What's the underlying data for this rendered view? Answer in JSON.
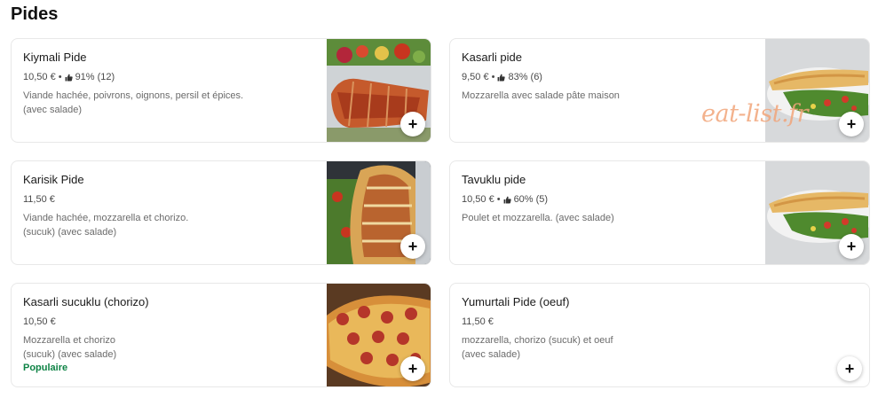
{
  "section": {
    "title": "Pides"
  },
  "items": [
    {
      "name": "Kiymali Pide",
      "price": "10,50 €",
      "rating": "91% (12)",
      "desc_line1": "Viande hachée, poivrons, oignons, persil et épices.",
      "desc_line2": "(avec salade)",
      "badge": "",
      "add_label": "+"
    },
    {
      "name": "Kasarli pide",
      "price": "9,50 €",
      "rating": "83% (6)",
      "desc_line1": "Mozzarella avec salade pâte maison",
      "desc_line2": "",
      "badge": "",
      "add_label": "+"
    },
    {
      "name": "Karisik Pide",
      "price": "11,50 €",
      "rating": "",
      "desc_line1": "Viande hachée, mozzarella et chorizo.",
      "desc_line2": "(sucuk) (avec salade)",
      "badge": "",
      "add_label": "+"
    },
    {
      "name": "Tavuklu pide",
      "price": "10,50 €",
      "rating": "60% (5)",
      "desc_line1": "Poulet et mozzarella. (avec salade)",
      "desc_line2": "",
      "badge": "",
      "add_label": "+"
    },
    {
      "name": "Kasarli sucuklu (chorizo)",
      "price": "10,50 €",
      "rating": "",
      "desc_line1": "Mozzarella et chorizo",
      "desc_line2": "(sucuk) (avec salade)",
      "badge": "Populaire",
      "add_label": "+"
    },
    {
      "name": "Yumurtali Pide (oeuf)",
      "price": "11,50 €",
      "rating": "",
      "desc_line1": "mozzarella, chorizo (sucuk) et oeuf",
      "desc_line2": "(avec salade)",
      "badge": "",
      "add_label": "+"
    }
  ],
  "separator": "•",
  "watermark": "eat-list.fr",
  "colors": {
    "popular": "#0e8345",
    "watermark": "#f2a57a",
    "border": "#e8e8e8"
  },
  "icons": {
    "rating": "thumbs-up-icon",
    "add": "plus-icon"
  }
}
